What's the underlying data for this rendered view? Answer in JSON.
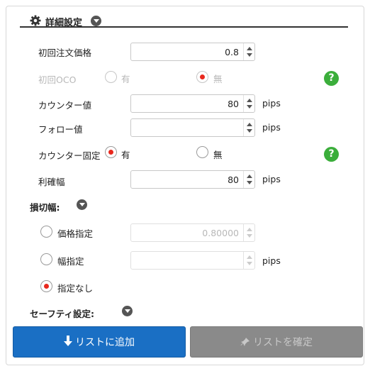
{
  "header": {
    "title": "詳細設定"
  },
  "rows": {
    "initial_price": {
      "label": "初回注文価格",
      "value": "0.8"
    },
    "initial_oco": {
      "label": "初回OCO",
      "opt_yes": "有",
      "opt_no": "無",
      "selected": "無"
    },
    "counter": {
      "label": "カウンター値",
      "value": "80",
      "unit": "pips"
    },
    "follow": {
      "label": "フォロー値",
      "value": "",
      "unit": "pips"
    },
    "counter_fixed": {
      "label": "カウンター固定",
      "opt_yes": "有",
      "opt_no": "無",
      "selected": "有"
    },
    "profit_width": {
      "label": "利確幅",
      "value": "80",
      "unit": "pips"
    }
  },
  "stop_loss": {
    "title": "損切幅:",
    "price_option": {
      "label": "価格指定",
      "value": "0.80000"
    },
    "width_option": {
      "label": "幅指定",
      "value": "",
      "unit": "pips"
    },
    "none_option": {
      "label": "指定なし"
    },
    "selected": "指定なし"
  },
  "safety": {
    "title": "セーフティ設定:"
  },
  "help_glyph": "?",
  "buttons": {
    "add": "リストに追加",
    "confirm": "リストを確定"
  },
  "colors": {
    "primary": "#1a6fc4",
    "radio_selected": "#e8281d",
    "help": "#3bae3b",
    "disabled_button": "#8a8a8a"
  }
}
